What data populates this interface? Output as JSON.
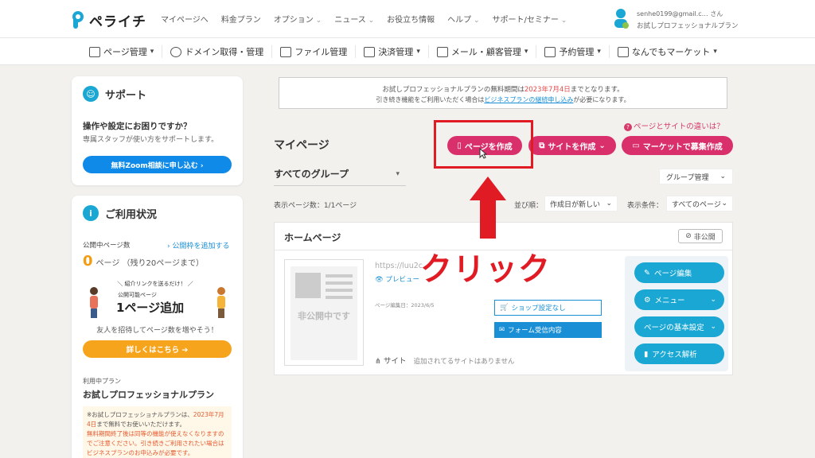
{
  "header": {
    "logo_text": "ペライチ",
    "nav": [
      "マイページへ",
      "料金プラン",
      "オプション",
      "ニュース",
      "お役立ち情報",
      "ヘルプ",
      "サポート/セミナー"
    ],
    "user_email": "senhe0199@gmail.c… さん",
    "user_plan": "お試しプロフェッショナルプラン"
  },
  "secnav": [
    "ページ管理",
    "ドメイン取得・管理",
    "ファイル管理",
    "決済管理",
    "メール・顧客管理",
    "予約管理",
    "なんでもマーケット"
  ],
  "support": {
    "title": "サポート",
    "question": "操作や設定にお困りですか？",
    "desc": "専属スタッフが使い方をサポートします。",
    "button": "無料Zoom相談に申し込む ›"
  },
  "usage": {
    "title": "ご利用状況",
    "pub_label": "公開中ページ数",
    "pub_add": "› 公開枠を追加する",
    "count": "0",
    "count_suffix": "ページ （残り20ページまで）",
    "promo_top": "＼ 紹介リンクを送るだけ！ ／",
    "promo_mid": "公開可能ページ",
    "promo_big": "1ページ追加",
    "promo_desc": "友人を招待してページ数を増やそう！",
    "detail_button": "詳しくはこちら ➔",
    "plan_label": "利用中プラン",
    "plan_name": "お試しプロフェッショナルプラン",
    "note_1": "※お試しプロフェッショナルプランは、",
    "note_date": "2023年7月4日",
    "note_2": "まで無料でお使いいただけます。",
    "note_3": "無料期間終了後は同等の機能が使えなくなりますのでご注意ください。引き続きご利用されたい場合はビジネスプランのお申込みが必要です。"
  },
  "notice": {
    "l1_a": "お試しプロフェッショナルプランの無料期間は",
    "l1_date": "2023年7月4日",
    "l1_b": "までとなります。",
    "l2_a": "引き続き機能をご利用いただく場合は",
    "l2_link": "ビジネスプランの継続申し込み",
    "l2_b": "が必要になります。"
  },
  "main": {
    "title": "マイページ",
    "diff_link": "ページとサイトの違いは？",
    "btn_page": "ページを作成",
    "btn_site": "サイトを作成",
    "btn_recruit": "マーケットで募集作成",
    "group": "すべてのグループ",
    "group_mgmt": "グループ管理",
    "count_text": "表示ページ数：1/1ページ",
    "sort_label": "並び順：",
    "sort_value": "作成日が新しい",
    "cond_label": "表示条件：",
    "cond_value": "すべてのページ"
  },
  "homepage": {
    "title": "ホームページ",
    "private": "非公開",
    "thumb_label": "非公開中です",
    "url": "https://luu2c",
    "preview": "プレビュー",
    "edited": "ページ編集日：2023/6/5",
    "shop": "ショップ設定なし",
    "form": "フォーム受信内容",
    "site_label": "サイト",
    "site_none": "追加されてるサイトはありません",
    "actions": [
      "ページ編集",
      "メニュー",
      "ページの基本設定",
      "アクセス解析"
    ]
  },
  "annotation": {
    "click": "クリック"
  },
  "colors": {
    "accent_pink": "#d9306b",
    "accent_blue": "#1aa7d4",
    "annotation_red": "#e01b24"
  }
}
